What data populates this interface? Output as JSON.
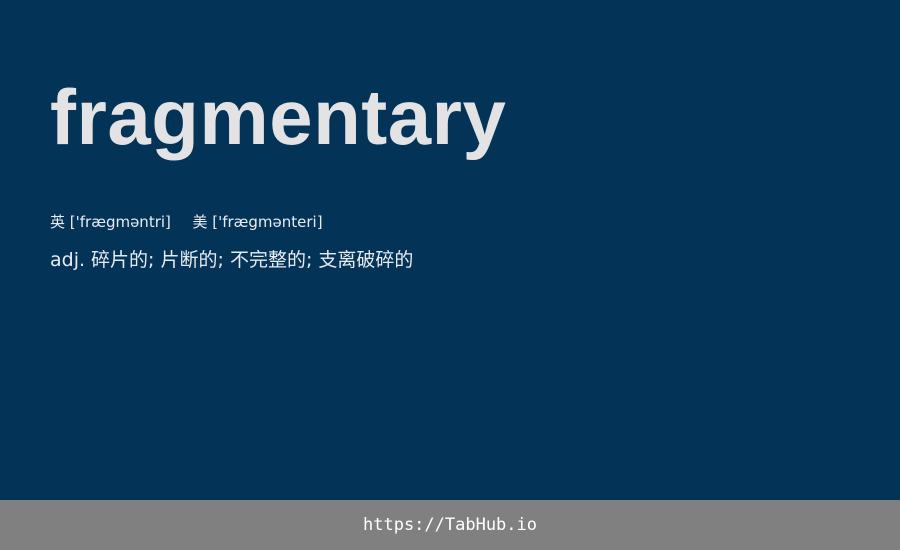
{
  "card": {
    "word": "fragmentary",
    "phonetic_uk_label": "英",
    "phonetic_uk": "['frægməntri]",
    "phonetic_us_label": "美",
    "phonetic_us": "['frægmənteri]",
    "definition": "adj. 碎片的; 片断的; 不完整的; 支离破碎的"
  },
  "footer": {
    "link": "https://TabHub.io"
  },
  "colors": {
    "background": "#033356",
    "word_text": "#e3e3e6",
    "footer_bg": "#808080"
  }
}
